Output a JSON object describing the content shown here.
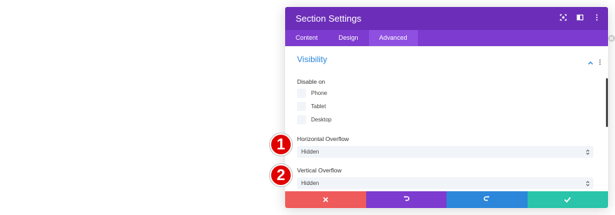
{
  "modal": {
    "title": "Section Settings",
    "tabs": [
      {
        "label": "Content"
      },
      {
        "label": "Design"
      },
      {
        "label": "Advanced"
      }
    ],
    "active_tab": "Advanced"
  },
  "visibility": {
    "title": "Visibility",
    "disable_on_label": "Disable on",
    "options": [
      {
        "label": "Phone"
      },
      {
        "label": "Tablet"
      },
      {
        "label": "Desktop"
      }
    ]
  },
  "horizontal_overflow": {
    "label": "Horizontal Overflow",
    "value": "Hidden",
    "step_number": "1"
  },
  "vertical_overflow": {
    "label": "Vertical Overflow",
    "value": "Hidden",
    "step_number": "2"
  },
  "footer": {
    "buttons": [
      {
        "icon": "close-icon",
        "color": "#ef5a5b"
      },
      {
        "icon": "undo-icon",
        "color": "#7e3bd0"
      },
      {
        "icon": "redo-icon",
        "color": "#2c87da"
      },
      {
        "icon": "check-icon",
        "color": "#29c4a9"
      }
    ]
  },
  "colors": {
    "header": "#6c2eb9",
    "tabs": "#7d3bcf",
    "active_tab": "#8f4fe0",
    "section_title": "#2b87da",
    "badge": "#e00000"
  }
}
